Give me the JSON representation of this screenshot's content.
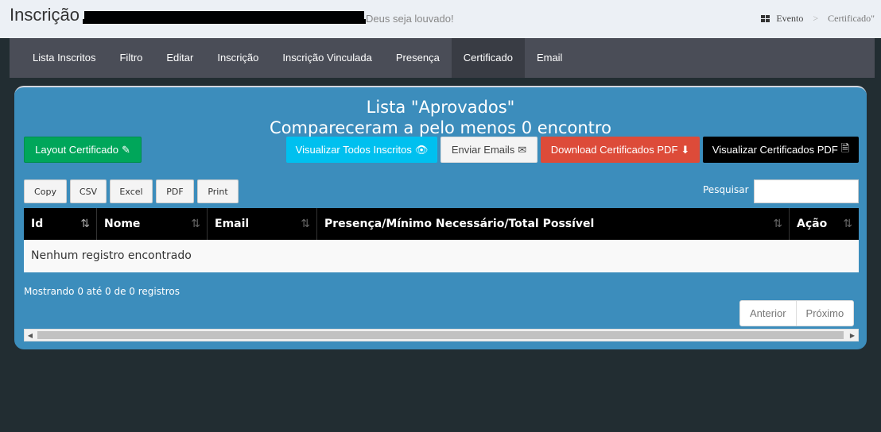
{
  "header": {
    "title": "Inscrição",
    "subtitle": "Deus seja louvado!",
    "breadcrumb": {
      "home_icon": "grid-icon",
      "home_label": "Evento",
      "separator": ">",
      "current": "Certificado\""
    }
  },
  "nav": {
    "items": [
      {
        "label": "Lista Inscritos"
      },
      {
        "label": "Filtro"
      },
      {
        "label": "Editar"
      },
      {
        "label": "Inscrição"
      },
      {
        "label": "Inscrição Vinculada"
      },
      {
        "label": "Presença"
      },
      {
        "label": "Certificado",
        "active": true
      },
      {
        "label": "Email"
      }
    ]
  },
  "panel": {
    "title_line1": "Lista \"Aprovados\"",
    "title_line2": "Compareceram a pelo menos 0 encontro"
  },
  "actions": {
    "layout_label": "Layout Certificado",
    "layout_icon": "✎",
    "visualizar_label": "Visualizar Todos Inscritos",
    "visualizar_icon": "👁",
    "email_label": "Enviar Emails",
    "email_icon": "✉",
    "download_label": "Download Certificados PDF",
    "download_icon": "⬇",
    "vispdf_label": "Visualizar Certificados PDF",
    "vispdf_icon": "🗎"
  },
  "export": {
    "copy": "Copy",
    "csv": "CSV",
    "excel": "Excel",
    "pdf": "PDF",
    "print": "Print"
  },
  "search": {
    "label": "Pesquisar",
    "value": ""
  },
  "table": {
    "columns": [
      {
        "label": "Id",
        "sort_icon": "⇅"
      },
      {
        "label": "Nome",
        "sort_icon": "⇅"
      },
      {
        "label": "Email",
        "sort_icon": "⇅"
      },
      {
        "label": "Presença/Mínimo Necessário/Total Possível",
        "sort_icon": "⇅"
      },
      {
        "label": "Ação",
        "sort_icon": "⇅"
      }
    ],
    "empty_message": "Nenhum registro encontrado"
  },
  "footer": {
    "info": "Mostrando 0 até 0 de 0 registros",
    "prev": "Anterior",
    "next": "Próximo"
  },
  "colors": {
    "panel": "#3c8dbc",
    "success": "#00a65a",
    "info": "#00c0ef",
    "danger": "#dd4b39",
    "nav": "#4a4d57",
    "background": "#222d32"
  }
}
